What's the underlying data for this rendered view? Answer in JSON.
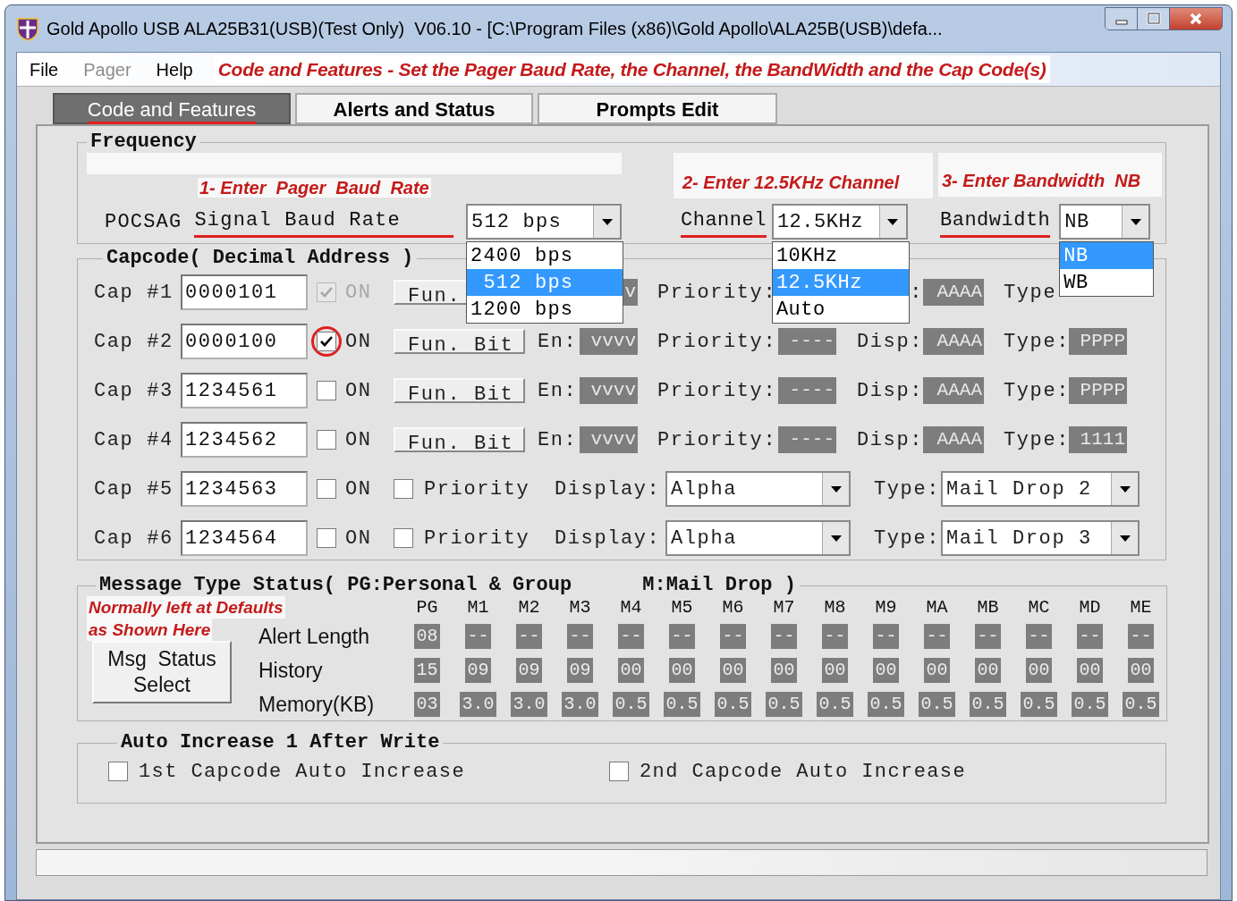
{
  "window": {
    "title": "Gold Apollo USB ALA25B31(USB)(Test Only)  V06.10 - [C:\\Program Files (x86)\\Gold Apollo\\ALA25B(USB)\\defa..."
  },
  "menu": [
    {
      "label": "File",
      "disabled": false
    },
    {
      "label": "Pager",
      "disabled": true
    },
    {
      "label": "Help",
      "disabled": false
    }
  ],
  "menu_note": "Code and Features - Set the Pager Baud Rate, the Channel, the BandWidth and the Cap Code(s)",
  "tabs": [
    {
      "label": "Code and Features",
      "selected": true,
      "underlined": true
    },
    {
      "label": "Alerts and Status",
      "selected": false,
      "underlined": false
    },
    {
      "label": "Prompts Edit",
      "selected": false,
      "underlined": false
    }
  ],
  "frequency": {
    "title": "Frequency",
    "baud": {
      "note": "1- Enter  Pager  Baud  Rate",
      "prefix": "POCSAG",
      "label": "Signal Baud Rate",
      "underlined": true,
      "value": "512 bps",
      "options": [
        {
          "label": "2400 bps",
          "selected": false
        },
        {
          "label": " 512 bps",
          "selected": true
        },
        {
          "label": "1200 bps",
          "selected": false
        }
      ]
    },
    "channel": {
      "note": "2- Enter 12.5KHz Channel",
      "label": "Channel",
      "underlined": true,
      "value": "12.5KHz",
      "options": [
        {
          "label": "10KHz",
          "selected": false
        },
        {
          "label": "12.5KHz",
          "selected": true
        },
        {
          "label": "Auto",
          "selected": false
        }
      ]
    },
    "bandwidth": {
      "note": "3- Enter Bandwidth  NB",
      "label": "Bandwidth",
      "underlined": true,
      "value": "NB",
      "options": [
        {
          "label": "NB",
          "selected": true
        },
        {
          "label": "WB",
          "selected": false
        }
      ]
    }
  },
  "capcode": {
    "title": "Capcode( Decimal Address )",
    "rows": [
      {
        "kind": "function",
        "label": "Cap #1",
        "value": "0000101",
        "on": true,
        "disabled": true,
        "circled": false,
        "on_label": "ON",
        "fun": "Fun.",
        "en_value": "v",
        "priority_label": "Priority:",
        "disp_label": ":",
        "disp_value": "AAAA",
        "type_label": "Type"
      },
      {
        "kind": "function",
        "label": "Cap #2",
        "value": "0000100",
        "on": true,
        "disabled": false,
        "circled": true,
        "on_label": "ON",
        "fun": "Fun. Bit",
        "en_label": "En:",
        "en_value": "vvvv",
        "priority_label": "Priority:",
        "priority_value": "----",
        "disp_label": "Disp:",
        "disp_value": "AAAA",
        "type_label": "Type:",
        "type_value": "PPPP"
      },
      {
        "kind": "function",
        "label": "Cap #3",
        "value": "1234561",
        "on": false,
        "disabled": false,
        "circled": false,
        "on_label": "ON",
        "fun": "Fun. Bit",
        "en_label": "En:",
        "en_value": "vvvv",
        "priority_label": "Priority:",
        "priority_value": "----",
        "disp_label": "Disp:",
        "disp_value": "AAAA",
        "type_label": "Type:",
        "type_value": "PPPP"
      },
      {
        "kind": "function",
        "label": "Cap #4",
        "value": "1234562",
        "on": false,
        "disabled": false,
        "circled": false,
        "on_label": "ON",
        "fun": "Fun. Bit",
        "en_label": "En:",
        "en_value": "vvvv",
        "priority_label": "Priority:",
        "priority_value": "----",
        "disp_label": "Disp:",
        "disp_value": "AAAA",
        "type_label": "Type:",
        "type_value": "1111"
      },
      {
        "kind": "priority",
        "label": "Cap #5",
        "value": "1234563",
        "on": false,
        "disabled": false,
        "circled": false,
        "on_label": "ON",
        "priority_checked": false,
        "priority_label": "Priority",
        "display_label": "Display:",
        "display_value": "Alpha",
        "type_label": "Type:",
        "type_value": "Mail Drop 2"
      },
      {
        "kind": "priority",
        "label": "Cap #6",
        "value": "1234564",
        "on": false,
        "disabled": false,
        "circled": false,
        "on_label": "ON",
        "priority_checked": false,
        "priority_label": "Priority",
        "display_label": "Display:",
        "display_value": "Alpha",
        "type_label": "Type:",
        "type_value": "Mail Drop 3"
      }
    ]
  },
  "message_types": {
    "title": "Message Type Status( PG:Personal & Group      M:Mail Drop )",
    "note": [
      "Normally left at Defaults",
      "as Shown Here"
    ],
    "button": [
      "Msg  Status",
      "Select"
    ],
    "columns": [
      "PG",
      "M1",
      "M2",
      "M3",
      "M4",
      "M5",
      "M6",
      "M7",
      "M8",
      "M9",
      "MA",
      "MB",
      "MC",
      "MD",
      "ME"
    ],
    "rows": [
      {
        "label": "Alert Length",
        "values": [
          "08",
          "--",
          "--",
          "--",
          "--",
          "--",
          "--",
          "--",
          "--",
          "--",
          "--",
          "--",
          "--",
          "--",
          "--"
        ]
      },
      {
        "label": "History",
        "values": [
          "15",
          "09",
          "09",
          "09",
          "00",
          "00",
          "00",
          "00",
          "00",
          "00",
          "00",
          "00",
          "00",
          "00",
          "00"
        ]
      },
      {
        "label": "Memory(KB)",
        "values": [
          "03",
          "3.0",
          "3.0",
          "3.0",
          "0.5",
          "0.5",
          "0.5",
          "0.5",
          "0.5",
          "0.5",
          "0.5",
          "0.5",
          "0.5",
          "0.5",
          "0.5"
        ]
      }
    ]
  },
  "auto_increase": {
    "title": "Auto Increase 1 After Write",
    "options": [
      {
        "label": "1st Capcode Auto Increase",
        "checked": false
      },
      {
        "label": "2nd Capcode Auto Increase",
        "checked": false
      }
    ]
  }
}
